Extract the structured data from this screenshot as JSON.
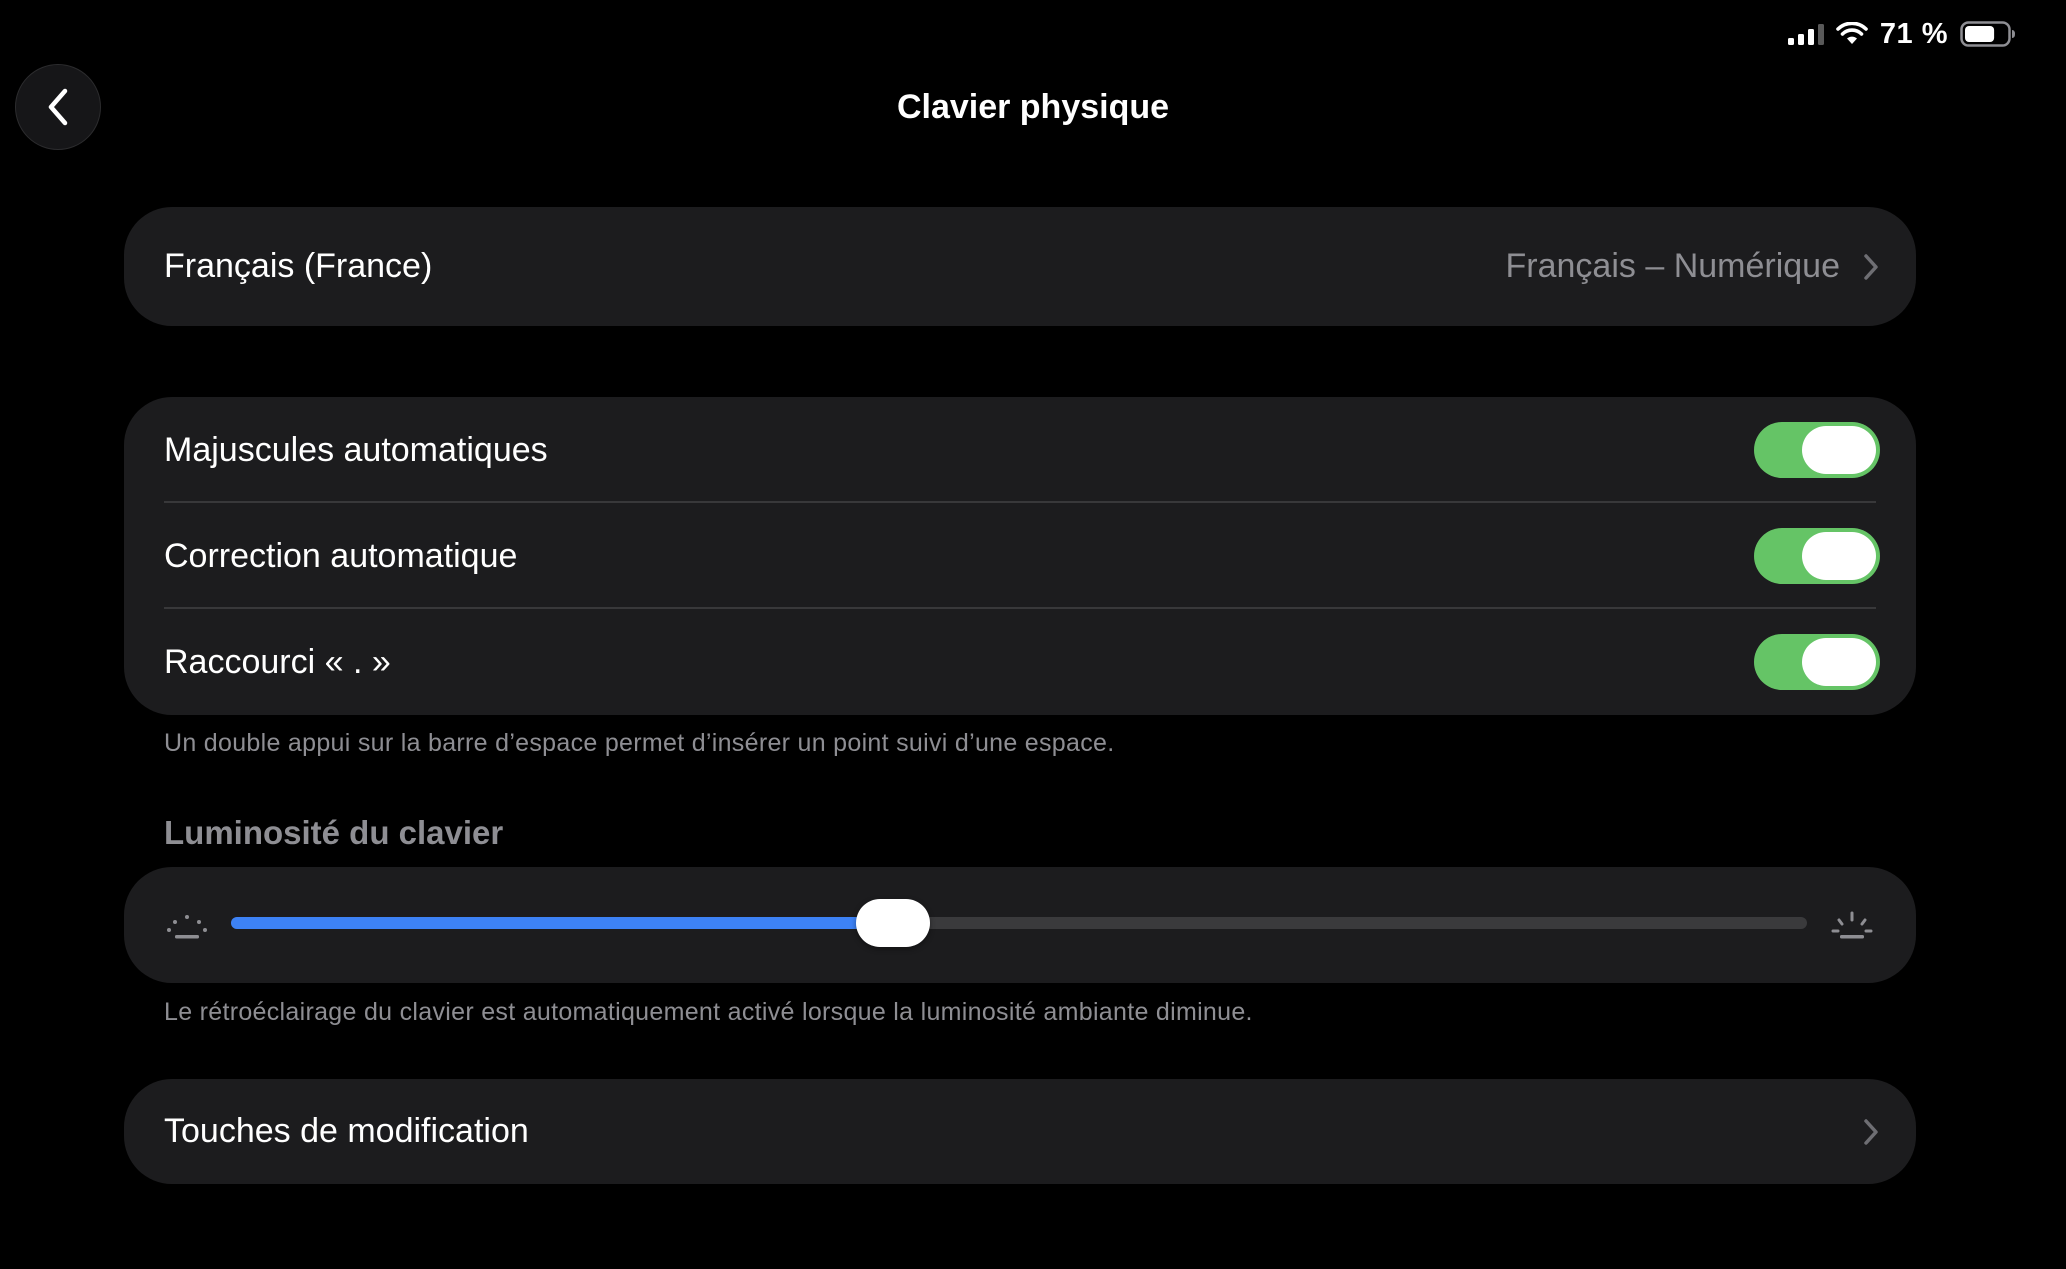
{
  "status_bar": {
    "battery_percent_text": "71 %",
    "battery_level": 0.71,
    "icons": [
      "cellular-signal-icon",
      "wifi-icon",
      "battery-icon"
    ]
  },
  "nav": {
    "back_icon": "chevron-left-icon",
    "title": "Clavier physique"
  },
  "language_row": {
    "label": "Français (France)",
    "value": "Français – Numérique",
    "icon": "chevron-right-icon"
  },
  "toggles": [
    {
      "label": "Majuscules automatiques",
      "on": true
    },
    {
      "label": "Correction automatique",
      "on": true
    },
    {
      "label": "Raccourci « . »",
      "on": true
    }
  ],
  "toggles_footnote": "Un double appui sur la barre d’espace permet d’insérer un point suivi d’une espace.",
  "brightness": {
    "header": "Luminosité du clavier",
    "level": 0.42,
    "low_icon": "keyboard-brightness-low-icon",
    "high_icon": "keyboard-brightness-high-icon",
    "footnote": "Le rétroéclairage du clavier est automatiquement activé lorsque la luminosité ambiante diminue."
  },
  "modifier_row": {
    "label": "Touches de modification",
    "icon": "chevron-right-icon"
  },
  "colors": {
    "background": "#000000",
    "group_background": "#1c1c1e",
    "toggle_on": "#65c466",
    "slider_fill": "#3d82f5",
    "secondary_text": "#8e8e93"
  }
}
